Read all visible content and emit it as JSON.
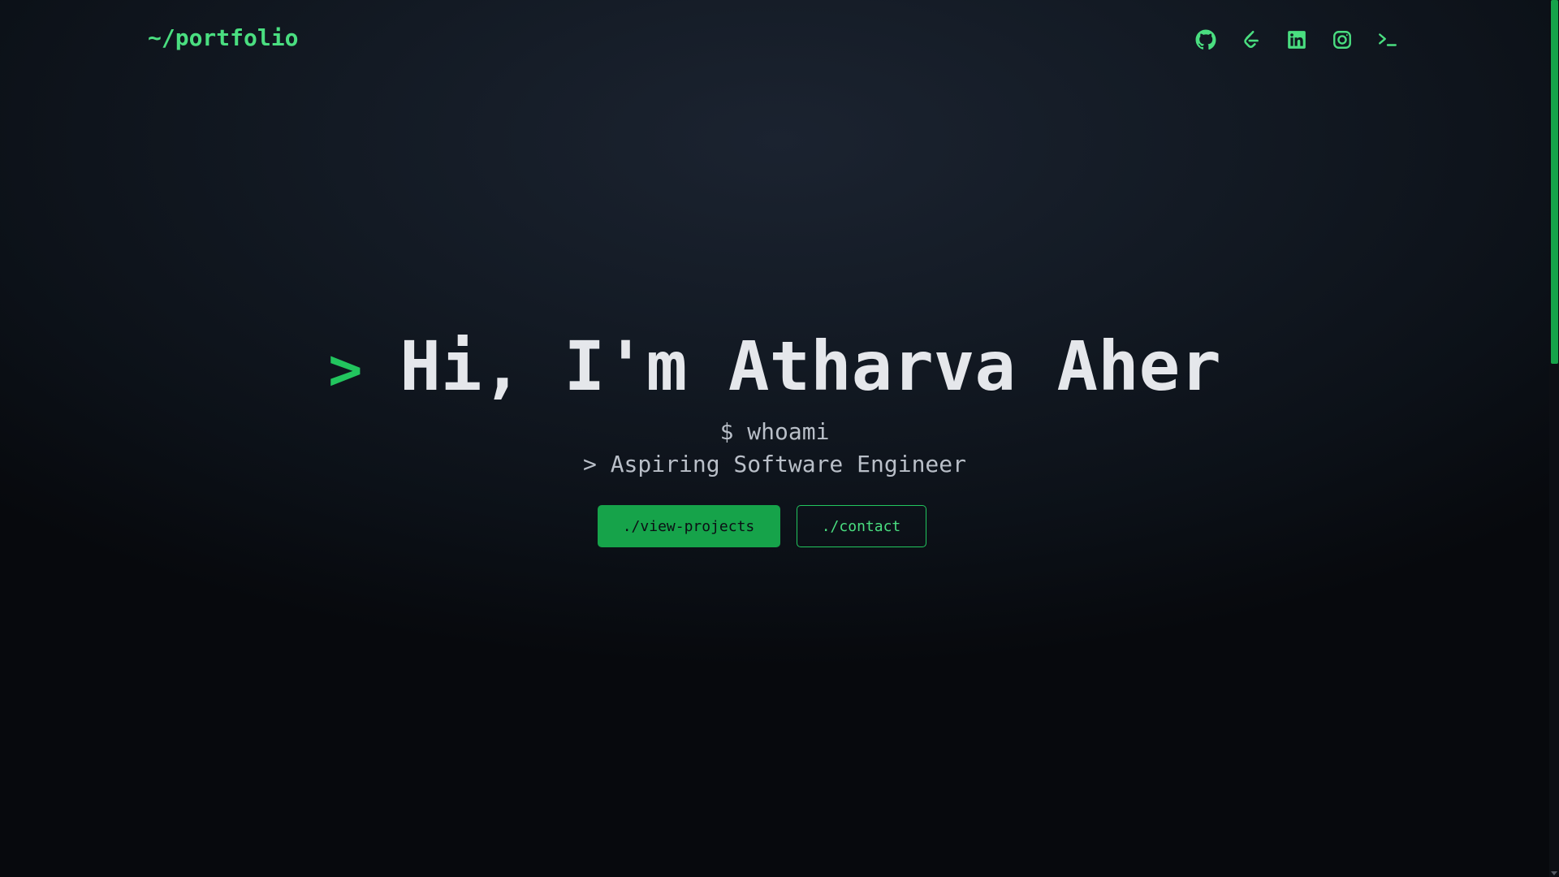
{
  "header": {
    "logo": "~/portfolio",
    "social": [
      {
        "name": "github-icon"
      },
      {
        "name": "leetcode-icon"
      },
      {
        "name": "linkedin-icon"
      },
      {
        "name": "instagram-icon"
      },
      {
        "name": "terminal-icon"
      }
    ]
  },
  "hero": {
    "prompt_symbol": ">",
    "title": "Hi, I'm Atharva Aher",
    "command": "$ whoami",
    "output": "> Aspiring Software Engineer"
  },
  "buttons": {
    "primary_label": "./view-projects",
    "secondary_label": "./contact"
  },
  "colors": {
    "accent": "#22c55e",
    "accent_light": "#4ade80",
    "button_fill": "#16a34a",
    "text": "#e5e7eb",
    "muted_text": "#b9bfc8",
    "background": "#0c1118"
  }
}
